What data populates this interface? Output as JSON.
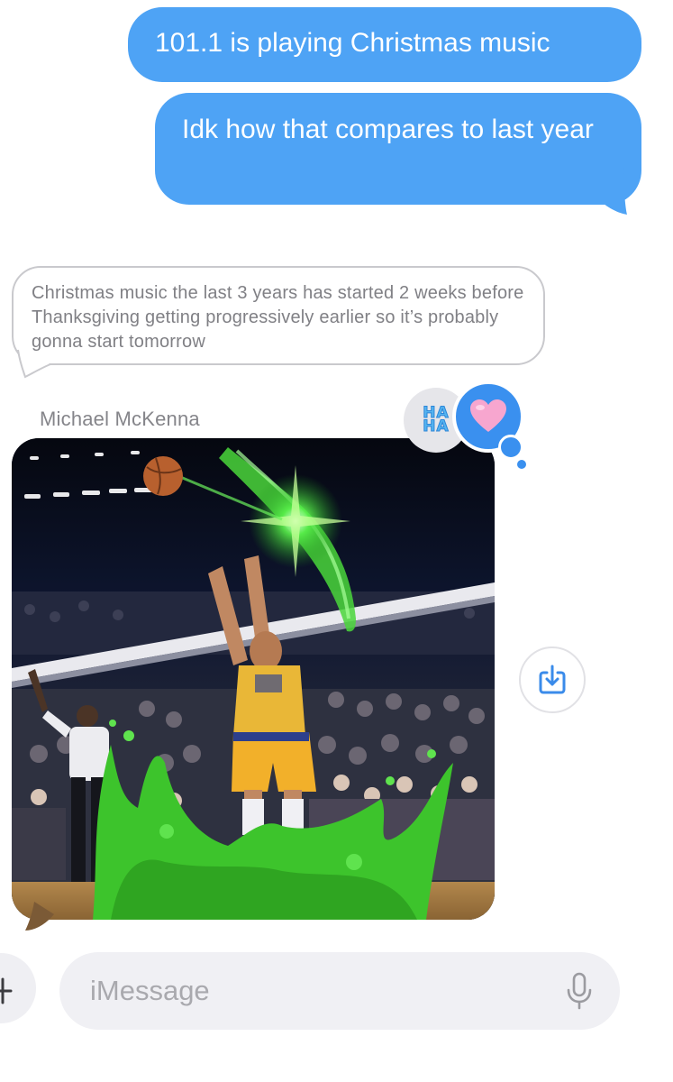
{
  "conversation": {
    "sent_messages": [
      {
        "text": "101.1 is playing Christmas music"
      },
      {
        "text": "Idk how that compares to last year"
      }
    ],
    "quoted_reply": {
      "text": "Christmas music the last 3 years has started 2 weeks before Thanksgiving getting progressively earlier so it’s probably gonna start tomorrow"
    },
    "received": {
      "sender_name": "Michael McKenna",
      "attachment": {
        "type": "gif",
        "description_icon": "image-attachment"
      },
      "tapbacks": [
        {
          "type": "haha",
          "label_line1": "HA",
          "label_line2": "HA"
        },
        {
          "type": "heart",
          "icon": "heart-icon"
        }
      ]
    }
  },
  "actions": {
    "save_icon": "save-download-icon"
  },
  "compose": {
    "placeholder": "iMessage",
    "plus_icon": "plus-icon",
    "mic_icon": "microphone-icon"
  },
  "colors": {
    "sent_bubble": "#4ea3f5",
    "accent_blue": "#3a90ef",
    "heart_pink": "#f7a6cf",
    "reply_border": "#c9c9cd",
    "compose_bg": "#f0f0f4"
  }
}
